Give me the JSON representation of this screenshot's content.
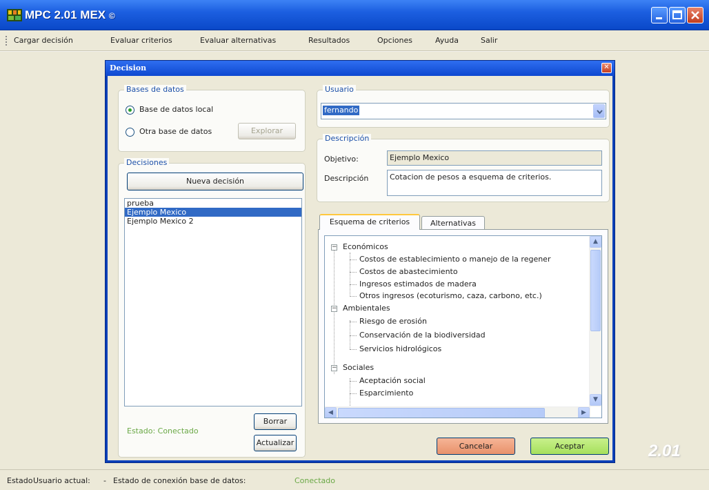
{
  "app": {
    "title": "MPC 2.01 MEX",
    "title_mark": "©",
    "watermark": "2.01"
  },
  "menu": [
    {
      "label": "Cargar decisión"
    },
    {
      "label": "Evaluar criterios"
    },
    {
      "label": "Evaluar alternativas"
    },
    {
      "label": "Resultados"
    },
    {
      "label": "Opciones"
    },
    {
      "label": "Ayuda"
    },
    {
      "label": "Salir"
    }
  ],
  "dialog": {
    "title": "Decision",
    "bases": {
      "legend": "Bases de datos",
      "local_label": "Base de datos local",
      "other_label": "Otra base de datos",
      "explore_label": "Explorar",
      "selected": "local"
    },
    "decisiones": {
      "legend": "Decisiones",
      "new_label": "Nueva decisión",
      "items": [
        "prueba",
        "Ejemplo Mexico",
        "Ejemplo Mexico 2"
      ],
      "selected_index": 1,
      "estado": "Estado: Conectado",
      "delete_label": "Borrar",
      "update_label": "Actualizar"
    },
    "usuario": {
      "legend": "Usuario",
      "value": "fernando"
    },
    "descripcion": {
      "legend": "Descripción",
      "objetivo_label": "Objetivo:",
      "objetivo_value": "Ejemplo Mexico",
      "descripcion_label": "Descripción",
      "descripcion_value": "Cotacion de pesos a esquema de criterios."
    },
    "tabs": [
      {
        "label": "Esquema de criterios",
        "active": true
      },
      {
        "label": "Alternativas",
        "active": false
      }
    ],
    "tree": [
      {
        "label": "Económicos",
        "level": 0
      },
      {
        "label": "Costos de establecimiento o manejo de la regener",
        "level": 1
      },
      {
        "label": "Costos de abastecimiento",
        "level": 1
      },
      {
        "label": "Ingresos estimados de madera",
        "level": 1
      },
      {
        "label": "Otros ingresos (ecoturismo, caza, carbono, etc.)",
        "level": 1
      },
      {
        "label": "Ambientales",
        "level": 0
      },
      {
        "label": "Riesgo de erosión",
        "level": 1
      },
      {
        "label": "Conservación de la biodiversidad",
        "level": 1
      },
      {
        "label": "Servicios hidrológicos",
        "level": 1
      },
      {
        "label": "Sociales",
        "level": 0
      },
      {
        "label": "Aceptación social",
        "level": 1
      },
      {
        "label": "Esparcimiento",
        "level": 1
      }
    ],
    "cancel_label": "Cancelar",
    "accept_label": "Aceptar",
    "colors": {
      "cancel": "#e8916b",
      "accept": "#a6e05c"
    }
  },
  "statusbar": {
    "estado_label": "Estado",
    "usuario_label": "Usuario actual:",
    "separator": "-",
    "conexion_label": "Estado de conexión base de datos:",
    "conexion_value": "Conectado"
  }
}
